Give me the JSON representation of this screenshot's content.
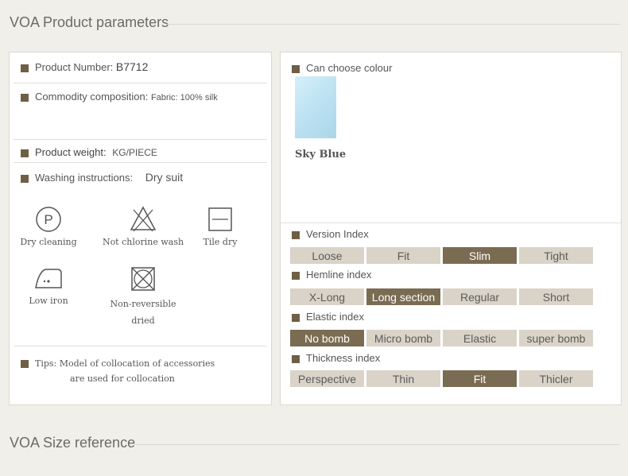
{
  "section1_title": "VOA Product parameters",
  "section2_title": "VOA Size reference",
  "product": {
    "number_label": "Product Number:",
    "number_value": "B7712",
    "composition_label": "Commodity composition:",
    "composition_value": "Fabric:  100%  silk",
    "weight_label": "Product  weight:",
    "weight_value": "KG/PIECE",
    "washing_label": "Washing instructions:",
    "washing_value": "Dry suit",
    "care": [
      {
        "icon": "dry-cleaning-icon",
        "label": "Dry cleaning"
      },
      {
        "icon": "no-chlorine-wash-icon",
        "label": "Not chlorine wash"
      },
      {
        "icon": "tile-dry-icon",
        "label": "Tile dry"
      },
      {
        "icon": "low-iron-icon",
        "label": "Low iron"
      },
      {
        "icon": "non-reversible-dried-icon",
        "label_1": "Non-reversible",
        "label_2": "dried"
      }
    ],
    "tips_label": "Tips:",
    "tips_line1": "Model of collocation of accessories",
    "tips_line2": "are used for collocation"
  },
  "colour": {
    "title": "Can choose colour",
    "name": "Sky Blue",
    "swatch": "#bfe3f2"
  },
  "indexes": [
    {
      "title": "Version Index",
      "options": [
        "Loose",
        "Fit",
        "Slim",
        "Tight"
      ],
      "selected": 2
    },
    {
      "title": "Hemline index",
      "options": [
        "X-Long",
        "Long  section",
        "Regular",
        "Short"
      ],
      "selected": 1
    },
    {
      "title": "Elastic index",
      "options": [
        "No  bomb",
        "Micro  bomb",
        "Elastic",
        "super  bomb"
      ],
      "selected": 0
    },
    {
      "title": "Thickness index",
      "options": [
        "Perspective",
        "Thin",
        "Fit",
        "Thicler"
      ],
      "selected": 2
    }
  ],
  "colors": {
    "accent": "#7a6c52",
    "option_bg": "#d9d3c8"
  }
}
